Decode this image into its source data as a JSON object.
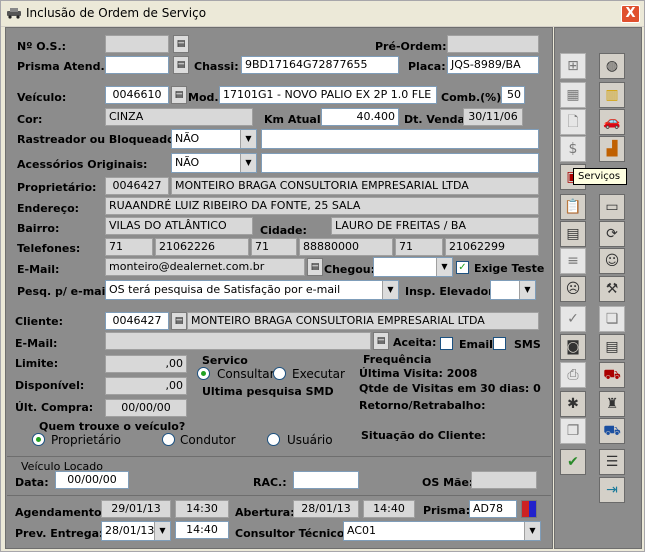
{
  "window": {
    "title": "Inclusão de Ordem de Serviço",
    "close_label": "X"
  },
  "header": {
    "nos_label": "Nº O.S.:",
    "nos_value": "",
    "preordem_label": "Pré-Ordem:",
    "preordem_value": "",
    "prisma_label": "Prisma Atend.:",
    "prisma_value": "",
    "chassi_label": "Chassi:",
    "chassi_value": "9BD17164G72877655",
    "placa_label": "Placa:",
    "placa_value": "JQS-8989/BA"
  },
  "veiculo": {
    "label": "Veículo:",
    "code": "0046610",
    "mod_label": "Mod.:",
    "mod_value": "17101G1 - NOVO PALIO EX 2P 1.0 FLE",
    "comb_label": "Comb.(%):",
    "comb_value": "50",
    "cor_label": "Cor:",
    "cor_value": "CINZA",
    "km_label": "Km Atual:",
    "km_value": "40.400",
    "dtvenda_label": "Dt. Venda:",
    "dtvenda_value": "30/11/06",
    "rastreador_label": "Rastreador ou Bloqueador:",
    "rastreador_value": "NÃO",
    "rastreador_text": "",
    "acessorios_label": "Acessórios Originais:",
    "acessorios_value": "NÃO",
    "acessorios_text": ""
  },
  "proprietario": {
    "label": "Proprietário:",
    "code": "0046427",
    "name": "MONTEIRO BRAGA CONSULTORIA EMPRESARIAL LTDA",
    "endereco_label": "Endereço:",
    "endereco_value": "RUAANDRÉ LUIZ RIBEIRO DA FONTE, 25 SALA",
    "bairro_label": "Bairro:",
    "bairro_value": "VILAS DO ATLÂNTICO",
    "cidade_label": "Cidade:",
    "cidade_value": "LAURO DE FREITAS / BA",
    "telefones_label": "Telefones:",
    "telefones": [
      "71",
      "21062226",
      "71",
      "88880000",
      "71",
      "21062299"
    ],
    "email_label": "E-Mail:",
    "email_value": "monteiro@dealernet.com.br",
    "chegou_label": "Chegou:",
    "chegou_value": "",
    "exige_teste_label": "Exige Teste",
    "exige_teste_check": "✓",
    "pesq_label": "Pesq. p/ e-mail:",
    "pesq_value": "OS terá pesquisa de Satisfação por e-mail",
    "insp_label": "Insp. Elevador:",
    "insp_value": ""
  },
  "cliente": {
    "label": "Cliente:",
    "code": "0046427",
    "name": "MONTEIRO BRAGA CONSULTORIA EMPRESARIAL LTDA",
    "email_label": "E-Mail:",
    "email_value": "",
    "aceita_label": "Aceita:",
    "email_opt_label": "Email",
    "sms_opt_label": "SMS",
    "limite_label": "Limite:",
    "limite_value": ",00",
    "disponivel_label": "Disponível:",
    "disponivel_value": ",00",
    "ultcompra_label": "Últ. Compra:",
    "ultcompra_value": "00/00/00"
  },
  "servico": {
    "title": "Servico",
    "consultar_label": "Consultar",
    "executar_label": "Executar",
    "ultima_pesquisa": "Ultima pesquisa SMD"
  },
  "frequencia": {
    "title": "Frequência",
    "ultima_visita": "Última Visita: 2008",
    "qtde_visitas": "Qtde de Visitas em 30 dias: 0",
    "retorno": "Retorno/Retrabalho:"
  },
  "quem_trouxe": {
    "title": "Quem trouxe o veículo?",
    "options": [
      "Proprietário",
      "Condutor",
      "Usuário"
    ],
    "situacao_label": "Situação do Cliente:"
  },
  "veiculo_locado": {
    "title": "Veículo Locado",
    "data_label": "Data:",
    "data_value": "00/00/00",
    "rac_label": "RAC.:",
    "rac_value": "",
    "osmae_label": "OS Mãe:",
    "osmae_value": ""
  },
  "footer": {
    "agendamento_label": "Agendamento:",
    "agendamento_date": "29/01/13",
    "agendamento_time": "14:30",
    "abertura_label": "Abertura:",
    "abertura_date": "28/01/13",
    "abertura_time": "14:40",
    "prisma_label": "Prisma:",
    "prisma_value": "AD78",
    "prev_label": "Prev. Entrega:",
    "prev_date": "28/01/13",
    "prev_time": "14:40",
    "consultor_label": "Consultor Técnico:",
    "consultor_value": "AC01"
  },
  "sidebar": {
    "tooltip": "Serviços"
  }
}
